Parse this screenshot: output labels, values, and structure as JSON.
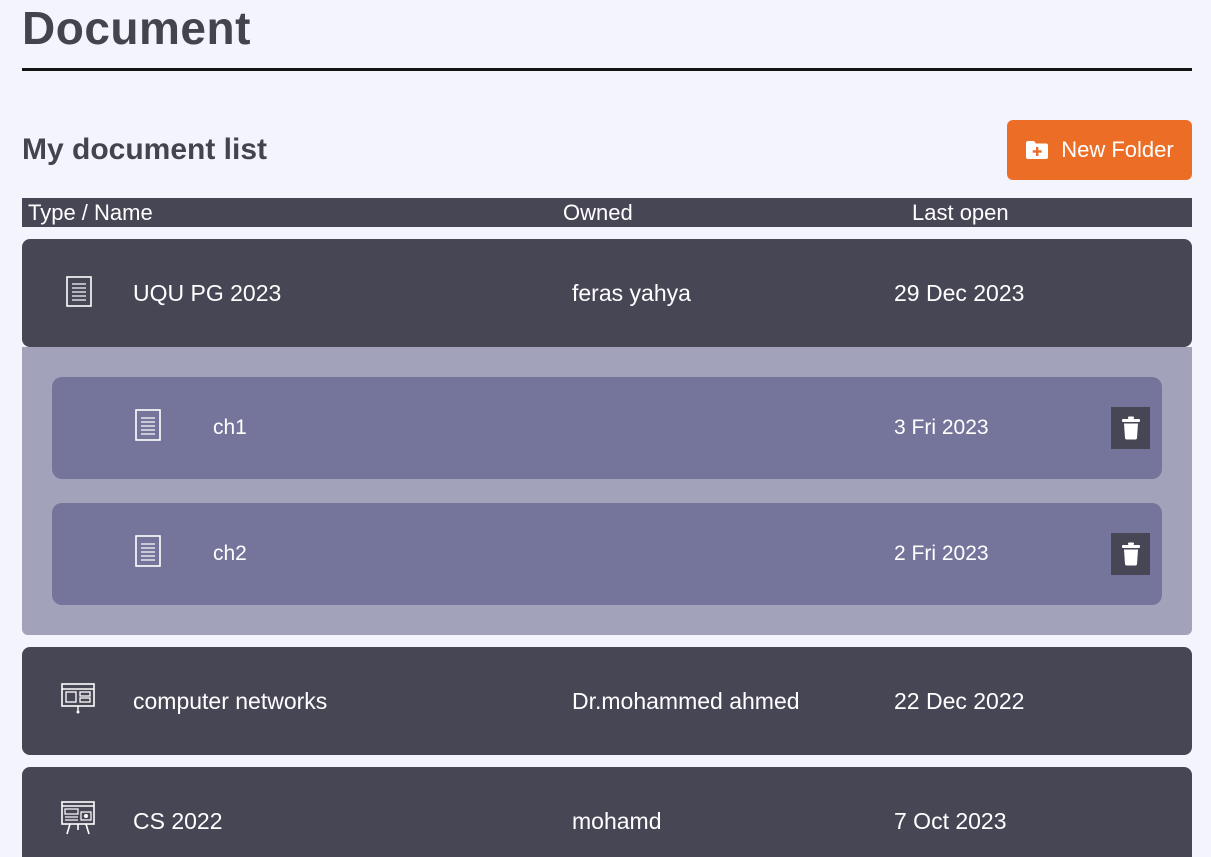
{
  "page": {
    "title": "Document",
    "section_title": "My document list"
  },
  "toolbar": {
    "new_folder_label": "New Folder"
  },
  "table": {
    "headers": {
      "name": "Type / Name",
      "owner": "Owned",
      "last_open": "Last open"
    },
    "rows": [
      {
        "icon": "document-icon",
        "name": "UQU PG 2023",
        "owner": "feras yahya",
        "last_open": "29 Dec 2023",
        "expanded": true,
        "children": [
          {
            "icon": "document-icon",
            "name": "ch1",
            "last_open": "3 Fri 2023"
          },
          {
            "icon": "document-icon",
            "name": "ch2",
            "last_open": "2 Fri 2023"
          }
        ]
      },
      {
        "icon": "presentation-icon",
        "name": "computer networks",
        "owner": "Dr.mohammed ahmed",
        "last_open": "22 Dec 2022"
      },
      {
        "icon": "presentation-board-icon",
        "name": "CS 2022",
        "owner": "mohamd",
        "last_open": "7 Oct 2023"
      }
    ]
  },
  "colors": {
    "background": "#f4f4fd",
    "row": "#474655",
    "expanded_panel": "#a2a2ba",
    "subrow": "#75759b",
    "accent": "#ec6d26"
  }
}
